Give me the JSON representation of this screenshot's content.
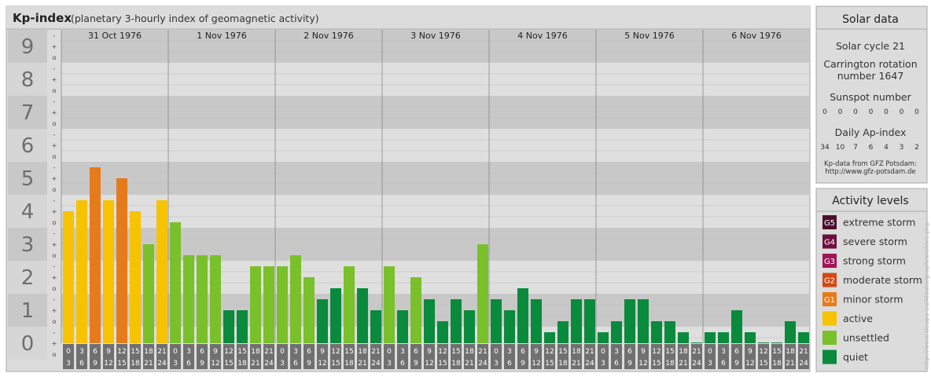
{
  "header": {
    "title": "Kp-index",
    "subtitle": "(planetary 3-hourly index of geomagnetic activity)"
  },
  "solar": {
    "title": "Solar data",
    "cycle": "Solar cycle 21",
    "carrington_line1": "Carrington rotation",
    "carrington_line2": "number 1647",
    "sunspot_title": "Sunspot number",
    "sunspot_values": [
      "0",
      "0",
      "0",
      "0",
      "0",
      "0",
      "0"
    ],
    "ap_title": "Daily Ap-index",
    "ap_values": [
      "34",
      "10",
      "7",
      "6",
      "4",
      "3",
      "2"
    ],
    "source_line1": "Kp-data from GFZ Potsdam:",
    "source_line2": "http://www.gfz-potsdam.de"
  },
  "legend": {
    "title": "Activity levels",
    "items": [
      {
        "badge": "G5",
        "label": "extreme storm",
        "color": "#4a0e2e"
      },
      {
        "badge": "G4",
        "label": "severe storm",
        "color": "#6d1040"
      },
      {
        "badge": "G3",
        "label": "strong storm",
        "color": "#a0155a"
      },
      {
        "badge": "G2",
        "label": "moderate storm",
        "color": "#d04a16"
      },
      {
        "badge": "G1",
        "label": "minor storm",
        "color": "#e57b1a"
      },
      {
        "badge": "",
        "label": "active",
        "color": "#f7c200"
      },
      {
        "badge": "",
        "label": "unsettled",
        "color": "#7ac02a"
      },
      {
        "badge": "",
        "label": "quiet",
        "color": "#0a8a3c"
      }
    ]
  },
  "watermark": "http://www.tieupa-eu/klaatu/graph/archive.php",
  "chart_data": {
    "type": "bar",
    "ylim": [
      0,
      9
    ],
    "y_ticks": [
      "0",
      "1",
      "2",
      "3",
      "4",
      "5",
      "6",
      "7",
      "8",
      "9"
    ],
    "y_minor_marks": [
      "o",
      "+",
      "-"
    ],
    "days": [
      "31 Oct 1976",
      "1 Nov 1976",
      "2 Nov 1976",
      "3 Nov 1976",
      "4 Nov 1976",
      "5 Nov 1976",
      "6 Nov 1976"
    ],
    "interval_starts": [
      "0",
      "3",
      "6",
      "9",
      "12",
      "15",
      "18",
      "21"
    ],
    "interval_ends": [
      "3",
      "6",
      "9",
      "12",
      "15",
      "18",
      "21",
      "24"
    ],
    "values": [
      4.0,
      4.333,
      5.333,
      4.333,
      5.0,
      4.0,
      3.0,
      4.333,
      3.667,
      2.667,
      2.667,
      2.667,
      1.0,
      1.0,
      2.333,
      2.333,
      2.333,
      2.667,
      2.0,
      1.333,
      1.667,
      2.333,
      1.667,
      1.0,
      2.333,
      1.0,
      2.0,
      1.333,
      0.667,
      1.333,
      1.0,
      3.0,
      1.333,
      1.0,
      1.667,
      1.333,
      0.333,
      0.667,
      1.333,
      1.333,
      0.333,
      0.667,
      1.333,
      1.333,
      0.667,
      0.667,
      0.333,
      0.0,
      0.333,
      0.333,
      1.0,
      0.333,
      0.0,
      0.0,
      0.667,
      0.333
    ],
    "colors": {
      "active": "#f7c200",
      "unsettled": "#7ac02a",
      "quiet": "#0a8a3c",
      "G1": "#e57b1a"
    }
  }
}
